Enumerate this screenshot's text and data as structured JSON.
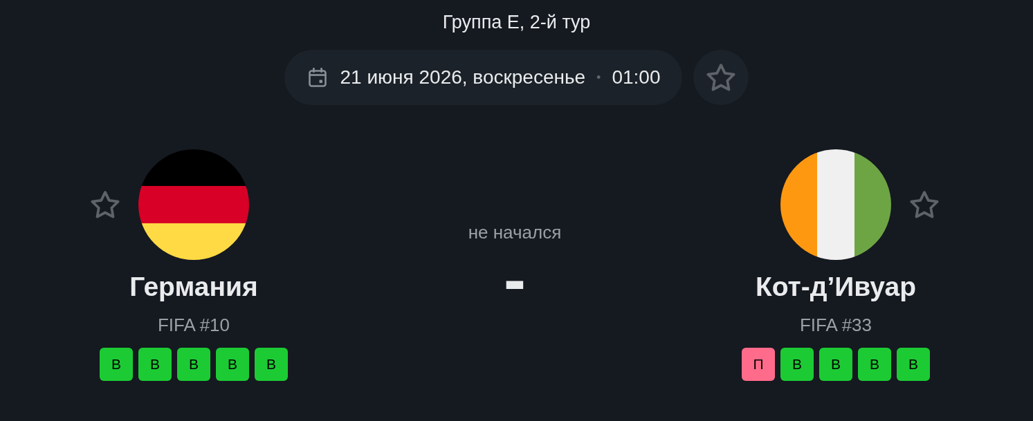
{
  "header": {
    "title": "Группа E, 2-й тур"
  },
  "schedule": {
    "date": "21 июня 2026, воскресенье",
    "separator": "•",
    "time": "01:00",
    "favorite": false
  },
  "teams": [
    {
      "name": "Германия",
      "ranking": "FIFA #10",
      "favorite": false,
      "flag": {
        "kind": "horizontal",
        "stripes": [
          {
            "color": "#000000"
          },
          {
            "color": "#d80027"
          },
          {
            "color": "#ffda44"
          }
        ]
      },
      "form": [
        {
          "label": "В",
          "color": "#1ccb34"
        },
        {
          "label": "В",
          "color": "#1ccb34"
        },
        {
          "label": "В",
          "color": "#1ccb34"
        },
        {
          "label": "В",
          "color": "#1ccb34"
        },
        {
          "label": "В",
          "color": "#1ccb34"
        }
      ]
    },
    {
      "name": "Кот-д’Ивуар",
      "ranking": "FIFA #33",
      "favorite": false,
      "flag": {
        "kind": "vertical",
        "stripes": [
          {
            "color": "#ff9811"
          },
          {
            "color": "#f0f0f0"
          },
          {
            "color": "#6da544"
          }
        ]
      },
      "form": [
        {
          "label": "П",
          "color": "#ff6b8b"
        },
        {
          "label": "В",
          "color": "#1ccb34"
        },
        {
          "label": "В",
          "color": "#1ccb34"
        },
        {
          "label": "В",
          "color": "#1ccb34"
        },
        {
          "label": "В",
          "color": "#1ccb34"
        }
      ]
    }
  ],
  "match": {
    "status": "не начался",
    "score": "-"
  }
}
